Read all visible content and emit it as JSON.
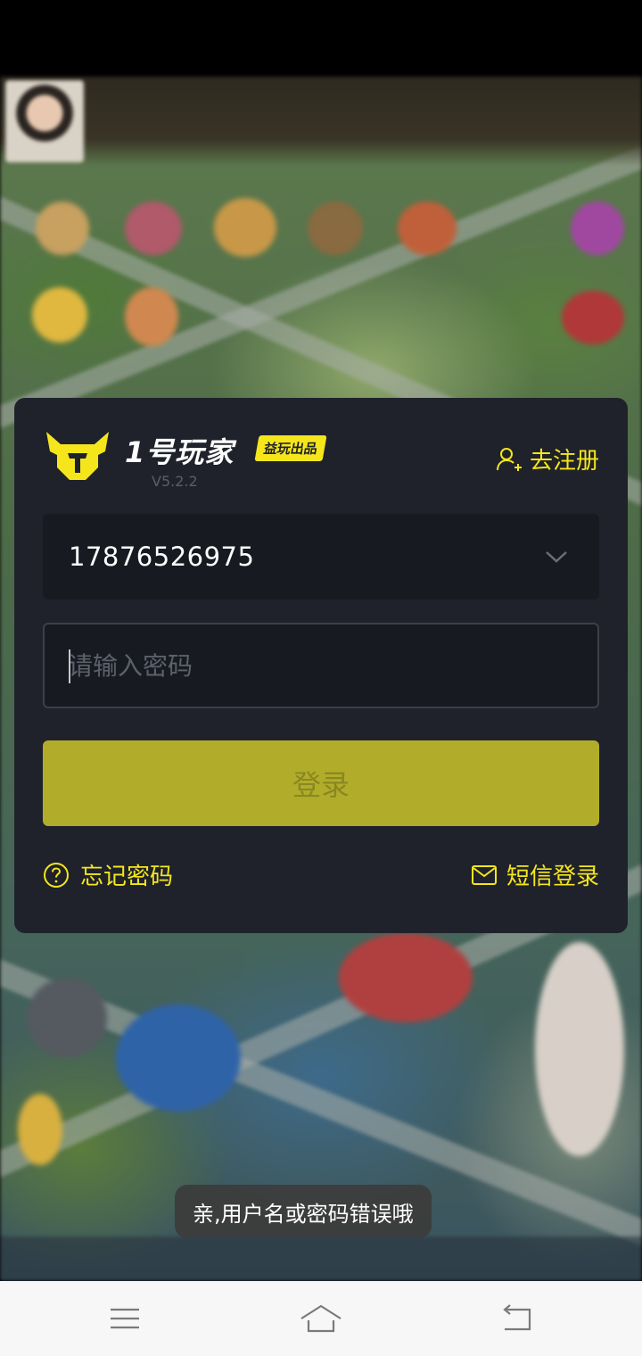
{
  "login": {
    "brand_name": "1号玩家",
    "brand_badge": "益玩出品",
    "version": "V5.2.2",
    "register_label": "去注册",
    "account_value": "17876526975",
    "password_placeholder": "请输入密码",
    "login_label": "登录",
    "forgot_label": "忘记密码",
    "sms_label": "短信登录"
  },
  "toast": {
    "message": "亲,用户名或密码错误哦"
  },
  "colors": {
    "accent": "#f5e61c",
    "card": "#1f222b",
    "button": "#b1ad2b"
  },
  "icons": [
    "helmet-logo-icon",
    "add-user-icon",
    "chevron-down-icon",
    "question-circle-icon",
    "mail-icon",
    "menu-icon",
    "home-icon",
    "back-icon"
  ]
}
